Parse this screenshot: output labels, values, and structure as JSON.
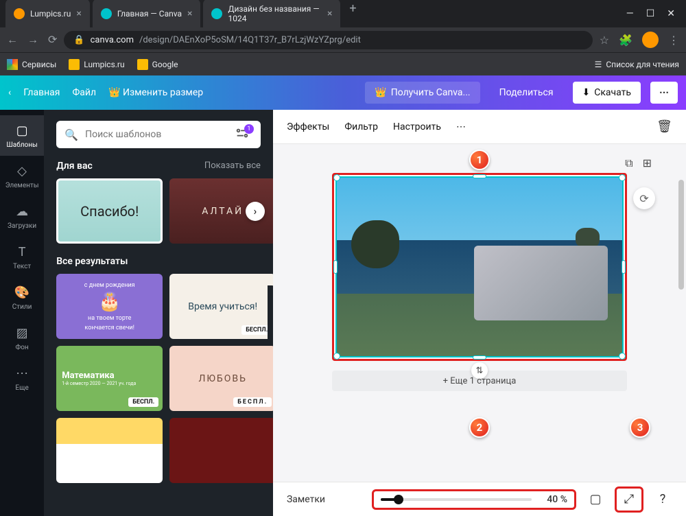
{
  "browser": {
    "tabs": [
      {
        "title": "Lumpics.ru",
        "favicon": "#ff9800"
      },
      {
        "title": "Главная — Canva",
        "favicon": "#00c4cc"
      },
      {
        "title": "Дизайн без названия — 1024",
        "favicon": "#00c4cc",
        "active": true
      }
    ],
    "url_domain": "canva.com",
    "url_path": "/design/DAEnXoP5oSM/14Q1T37r_B7rLzjWzYZprg/edit",
    "bookmarks": [
      "Сервисы",
      "Lumpics.ru",
      "Google"
    ],
    "reading_list": "Список для чтения"
  },
  "canva_top": {
    "home": "Главная",
    "file": "Файл",
    "resize": "Изменить размер",
    "get_pro": "Получить Canva...",
    "share": "Поделиться",
    "download": "Скачать"
  },
  "sidebar": {
    "items": [
      {
        "label": "Шаблоны"
      },
      {
        "label": "Элементы"
      },
      {
        "label": "Загрузки"
      },
      {
        "label": "Текст"
      },
      {
        "label": "Стили"
      },
      {
        "label": "Фон"
      },
      {
        "label": "Еще"
      }
    ]
  },
  "panel": {
    "search_placeholder": "Поиск шаблонов",
    "filter_count": "1",
    "section_foryou": "Для вас",
    "show_all": "Показать все",
    "section_results": "Все результаты",
    "badge_free": "БЕСПЛ.",
    "templates": {
      "t1": "Спасибо!",
      "t2": "АЛТАЙ",
      "t3_line1": "с днем рождения",
      "t3_line2": "на твоем торте",
      "t3_line3": "кончается свечи!",
      "t4": "Время учиться!",
      "t5": "Математика",
      "t5_sub": "1-й семестр 2020 — 2021 уч. года",
      "t6": "ЛЮБОВЬ"
    }
  },
  "ctx": {
    "effects": "Эффекты",
    "filter": "Фильтр",
    "adjust": "Настроить"
  },
  "workspace": {
    "add_page": "+ Еще 1 страница"
  },
  "bottom": {
    "notes": "Заметки",
    "zoom": "40 %"
  },
  "callouts": {
    "c1": "1",
    "c2": "2",
    "c3": "3"
  }
}
